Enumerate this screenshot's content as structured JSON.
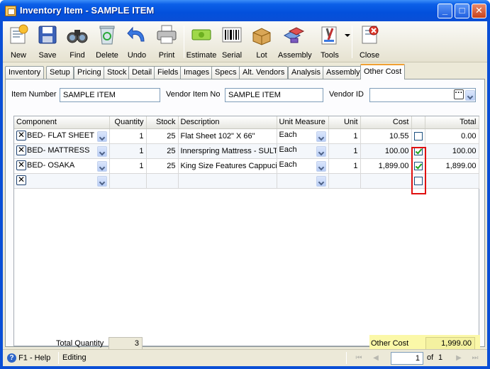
{
  "window": {
    "title": "Inventory Item - SAMPLE ITEM"
  },
  "titlebar_buttons": {
    "minimize": "_",
    "maximize": "□",
    "close": "✕"
  },
  "toolbar": {
    "new": "New",
    "save": "Save",
    "find": "Find",
    "delete": "Delete",
    "undo": "Undo",
    "print": "Print",
    "estimate": "Estimate",
    "serial": "Serial",
    "lot": "Lot",
    "assembly": "Assembly",
    "tools": "Tools",
    "close": "Close"
  },
  "tabs": [
    "Inventory",
    "Setup",
    "Pricing",
    "Stock",
    "Detail",
    "Fields",
    "Images",
    "Specs",
    "Alt. Vendors",
    "Analysis",
    "Assembly",
    "Other Cost"
  ],
  "form": {
    "item_number_label": "Item Number",
    "item_number_value": "SAMPLE ITEM",
    "vendor_item_no_label": "Vendor Item No",
    "vendor_item_no_value": "SAMPLE ITEM",
    "vendor_id_label": "Vendor ID",
    "vendor_id_value": "",
    "ellipsis": "···"
  },
  "grid": {
    "columns": [
      "Component",
      "Quantity",
      "Stock",
      "Description",
      "Unit Measure",
      "Unit",
      "Cost",
      "",
      "Total"
    ],
    "rows": [
      {
        "component": "BED- FLAT SHEET",
        "quantity": "1",
        "stock": "25",
        "description": "Flat Sheet 102\" X 66\"",
        "unit_measure": "Each",
        "unit": "1",
        "cost": "10.55",
        "other_cost": false,
        "total": "0.00"
      },
      {
        "component": "BED- MATTRESS",
        "quantity": "1",
        "stock": "25",
        "description": "Innerspring Mattress - SULT",
        "unit_measure": "Each",
        "unit": "1",
        "cost": "100.00",
        "other_cost": true,
        "total": "100.00"
      },
      {
        "component": "BED- OSAKA",
        "quantity": "1",
        "stock": "25",
        "description": "King Size Features Cappucin",
        "unit_measure": "Each",
        "unit": "1",
        "cost": "1,899.00",
        "other_cost": true,
        "total": "1,899.00"
      }
    ],
    "delete_glyph": "✕"
  },
  "totals": {
    "total_quantity_label": "Total Quantity",
    "total_quantity_value": "3",
    "other_cost_label": "Other Cost",
    "other_cost_value": "1,999.00"
  },
  "status": {
    "help": "F1 - Help",
    "mode": "Editing",
    "page": "1",
    "of_label": "of",
    "page_count": "1"
  },
  "colors": {
    "accent": "#0a4fd6",
    "highlight": "#fbf8a8",
    "check": "#21a121",
    "callout": "#e01010"
  }
}
